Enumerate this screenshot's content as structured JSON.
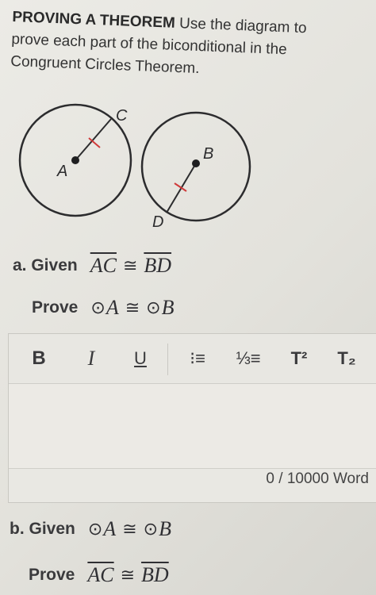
{
  "intro": {
    "title": "PROVING A THEOREM",
    "text": "Use the diagram to prove each part of the biconditional in the Congruent Circles Theorem."
  },
  "diagram": {
    "labels": {
      "c": "C",
      "a": "A",
      "b": "B",
      "d": "D"
    },
    "stroke_color": "#2c2c2e",
    "tick_color": "#d03a3a"
  },
  "part_a": {
    "given_label": "a. Given",
    "given_seg1": "AC",
    "given_op": "≅",
    "given_seg2": "BD",
    "prove_label": "Prove",
    "prove_c1": "A",
    "prove_op": "≅",
    "prove_c2": "B"
  },
  "editor": {
    "toolbar": {
      "bold": "B",
      "italic": "I",
      "underline": "U",
      "bullet_list": "⁝≡",
      "numbered_list": "⅓≡",
      "superscript": "T²",
      "subscript": "T₂"
    },
    "word_count": "0 / 10000 Word"
  },
  "part_b": {
    "given_label": "b. Given",
    "given_c1": "A",
    "given_op": "≅",
    "given_c2": "B",
    "prove_label": "Prove",
    "prove_seg1": "AC",
    "prove_op": "≅",
    "prove_seg2": "BD"
  }
}
